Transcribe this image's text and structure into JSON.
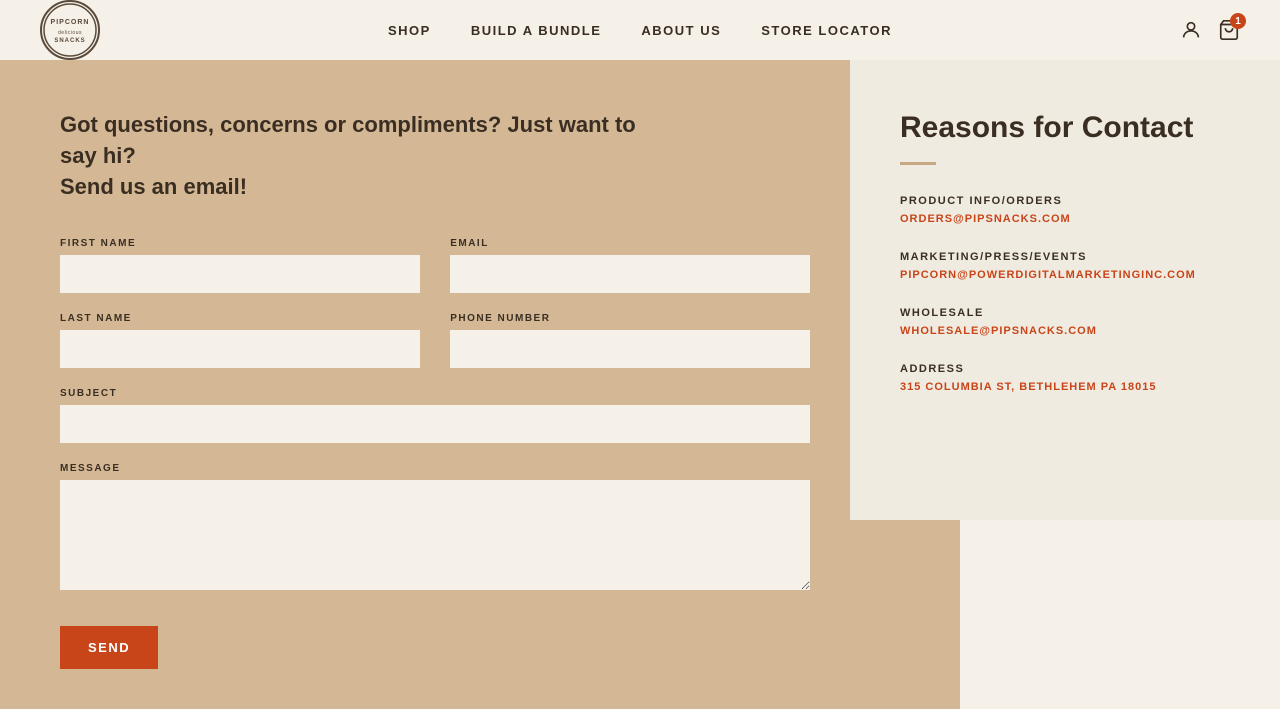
{
  "header": {
    "logo_alt": "Pipcorn Snacks",
    "nav": {
      "items": [
        {
          "label": "SHOP",
          "href": "#"
        },
        {
          "label": "BUILD A BUNDLE",
          "href": "#"
        },
        {
          "label": "ABOUT US",
          "href": "#"
        },
        {
          "label": "STORE LOCATOR",
          "href": "#"
        }
      ]
    },
    "cart_count": "1"
  },
  "page": {
    "headline_line1": "Got questions, concerns or compliments? Just want to say hi?",
    "headline_line2": "Send us an email!",
    "form": {
      "first_name_label": "FIRST NAME",
      "last_name_label": "LAST NAME",
      "email_label": "EMAIL",
      "phone_label": "PHONE NUMBER",
      "subject_label": "SUBJECT",
      "message_label": "MESSAGE",
      "send_button": "SEND"
    },
    "contact_card": {
      "title": "Reasons for Contact",
      "items": [
        {
          "label": "PRODUCT INFO/ORDERS",
          "value": "ORDERS@PIPSNACKS.COM"
        },
        {
          "label": "MARKETING/PRESS/EVENTS",
          "value": "PIPCORN@POWERDIGITALMARKETINGINC.COM"
        },
        {
          "label": "WHOLESALE",
          "value": "WHOLESALE@PIPSNACKS.COM"
        },
        {
          "label": "ADDRESS",
          "value": "315 COLUMBIA ST, BETHLEHEM PA 18015"
        }
      ]
    }
  }
}
